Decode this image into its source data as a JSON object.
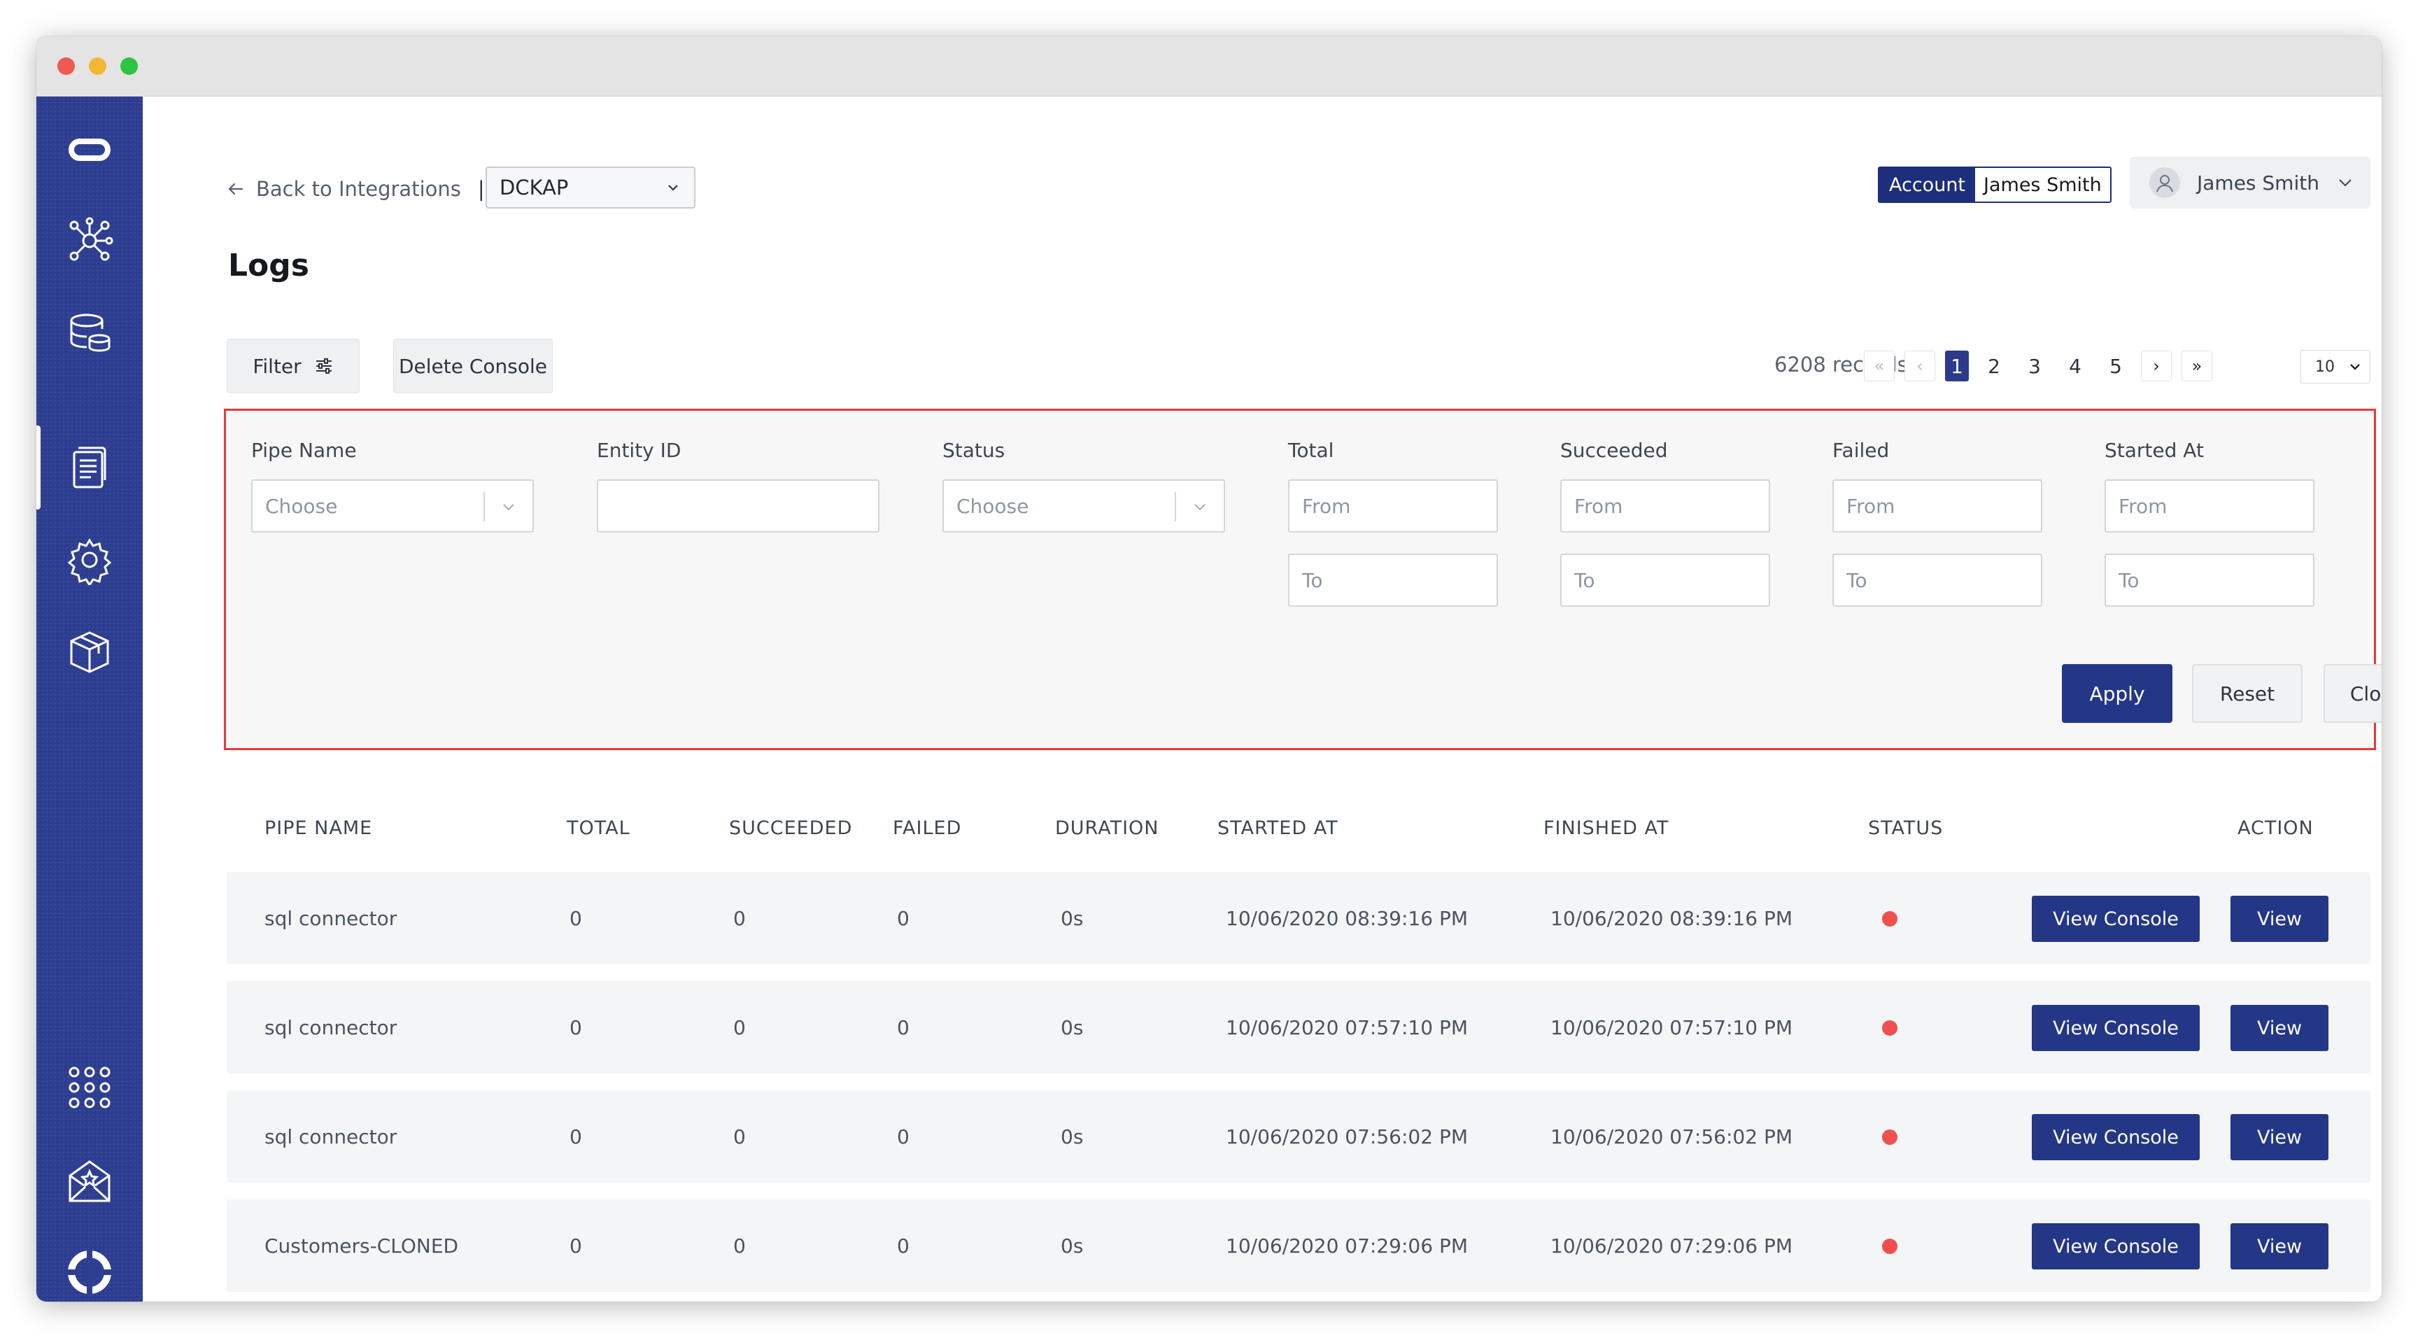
{
  "header": {
    "back_label": "Back to Integrations",
    "separator": "|",
    "integration_select": "DCKAP",
    "account_toggle": {
      "primary": "Account",
      "secondary": "James Smith"
    },
    "user_name": "James Smith"
  },
  "page": {
    "title": "Logs"
  },
  "toolbar": {
    "filter_label": "Filter",
    "delete_console_label": "Delete Console",
    "records_label": "6208 records",
    "pages": [
      "1",
      "2",
      "3",
      "4",
      "5"
    ],
    "current_page": "1",
    "page_size": "10"
  },
  "filter": {
    "pipe_name_label": "Pipe Name",
    "pipe_name_placeholder": "Choose",
    "entity_id_label": "Entity ID",
    "status_label": "Status",
    "status_placeholder": "Choose",
    "total_label": "Total",
    "succeeded_label": "Succeeded",
    "failed_label": "Failed",
    "started_at_label": "Started At",
    "from_placeholder": "From",
    "to_placeholder": "To",
    "apply_label": "Apply",
    "reset_label": "Reset",
    "close_label": "Close"
  },
  "table": {
    "columns": [
      "PIPE NAME",
      "TOTAL",
      "SUCCEEDED",
      "FAILED",
      "DURATION",
      "STARTED AT",
      "FINISHED AT",
      "STATUS",
      "ACTION"
    ],
    "view_console_label": "View Console",
    "view_label": "View",
    "status_color": "#ef4f4f",
    "rows": [
      {
        "pipe_name": "sql connector",
        "total": "0",
        "succeeded": "0",
        "failed": "0",
        "duration": "0s",
        "started_at": "10/06/2020 08:39:16 PM",
        "finished_at": "10/06/2020 08:39:16 PM"
      },
      {
        "pipe_name": "sql connector",
        "total": "0",
        "succeeded": "0",
        "failed": "0",
        "duration": "0s",
        "started_at": "10/06/2020 07:57:10 PM",
        "finished_at": "10/06/2020 07:57:10 PM"
      },
      {
        "pipe_name": "sql connector",
        "total": "0",
        "succeeded": "0",
        "failed": "0",
        "duration": "0s",
        "started_at": "10/06/2020 07:56:02 PM",
        "finished_at": "10/06/2020 07:56:02 PM"
      },
      {
        "pipe_name": "Customers-CLONED",
        "total": "0",
        "succeeded": "0",
        "failed": "0",
        "duration": "0s",
        "started_at": "10/06/2020 07:29:06 PM",
        "finished_at": "10/06/2020 07:29:06 PM"
      }
    ]
  },
  "sidebar": {
    "icons": [
      "logo-icon",
      "network-icon",
      "database-icon",
      "logs-icon",
      "settings-icon",
      "package-icon",
      "apps-grid-icon",
      "mail-star-icon",
      "help-lifebuoy-icon"
    ]
  },
  "colors": {
    "sidebar": "#2d3e91",
    "primary": "#243686",
    "highlight_border": "#e23b3b"
  }
}
